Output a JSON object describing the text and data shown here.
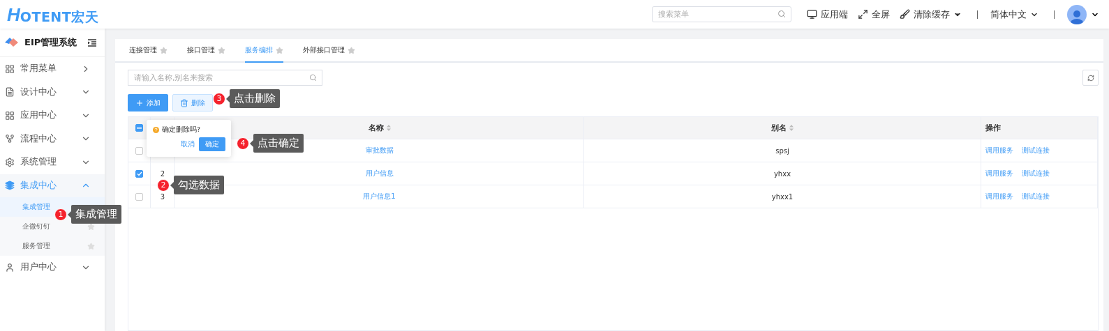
{
  "header": {
    "logo_mark": "H",
    "logo_text": "OTENT宏天",
    "search": {
      "placeholder": "搜索菜单"
    },
    "actions": [
      {
        "label": "应用端",
        "dropdown": false
      },
      {
        "label": "全屏",
        "dropdown": false
      },
      {
        "label": "清除缓存",
        "dropdown": true
      }
    ],
    "language": "简体中文"
  },
  "sidebar": {
    "title": "EIP管理系统",
    "items": [
      {
        "label": "常用菜单",
        "expanded": false,
        "kind": "link"
      },
      {
        "label": "设计中心",
        "expanded": false,
        "kind": "group"
      },
      {
        "label": "应用中心",
        "expanded": false,
        "kind": "group"
      },
      {
        "label": "流程中心",
        "expanded": false,
        "kind": "group"
      },
      {
        "label": "系统管理",
        "expanded": false,
        "kind": "group"
      },
      {
        "label": "集成中心",
        "expanded": true,
        "kind": "group",
        "children": [
          {
            "label": "集成管理",
            "selected": true
          },
          {
            "label": "企微钉钉",
            "selected": false
          },
          {
            "label": "服务管理",
            "selected": false
          }
        ]
      },
      {
        "label": "用户中心",
        "expanded": false,
        "kind": "group"
      }
    ]
  },
  "tabs": [
    {
      "label": "连接管理",
      "selected": false
    },
    {
      "label": "接口管理",
      "selected": false
    },
    {
      "label": "服务编排",
      "selected": true
    },
    {
      "label": "外部接口管理",
      "selected": false
    }
  ],
  "search": {
    "placeholder": "请输入名称,别名来搜索"
  },
  "buttons": [
    {
      "label": "添加",
      "kind": "primary"
    },
    {
      "label": "删除",
      "kind": "danger"
    }
  ],
  "table": {
    "select_all": {
      "indeterminate": true
    },
    "columns": [
      {
        "label": "名称",
        "sortable": true
      },
      {
        "label": "别名",
        "sortable": true
      },
      {
        "label": "操作",
        "sortable": false
      }
    ],
    "rows": [
      {
        "checked": false,
        "name": "审批数据",
        "alias": "spsj",
        "actions": [
          "调用服务",
          "测试连接"
        ]
      },
      {
        "checked": true,
        "index": "2",
        "name": "用户信息",
        "alias": "yhxx",
        "actions": [
          "调用服务",
          "测试连接"
        ]
      },
      {
        "checked": false,
        "index": "3",
        "name": "用户信息1",
        "alias": "yhxx1",
        "actions": [
          "调用服务",
          "测试连接"
        ]
      }
    ]
  },
  "popconfirm": {
    "message": "确定删除吗?",
    "cancel": "取消",
    "ok": "确定"
  },
  "annotations": [
    {
      "number": "1",
      "text": "集成管理"
    },
    {
      "number": "2",
      "text": "勾选数据"
    },
    {
      "number": "3",
      "text": "点击删除"
    },
    {
      "number": "4",
      "text": "点击确定"
    }
  ]
}
